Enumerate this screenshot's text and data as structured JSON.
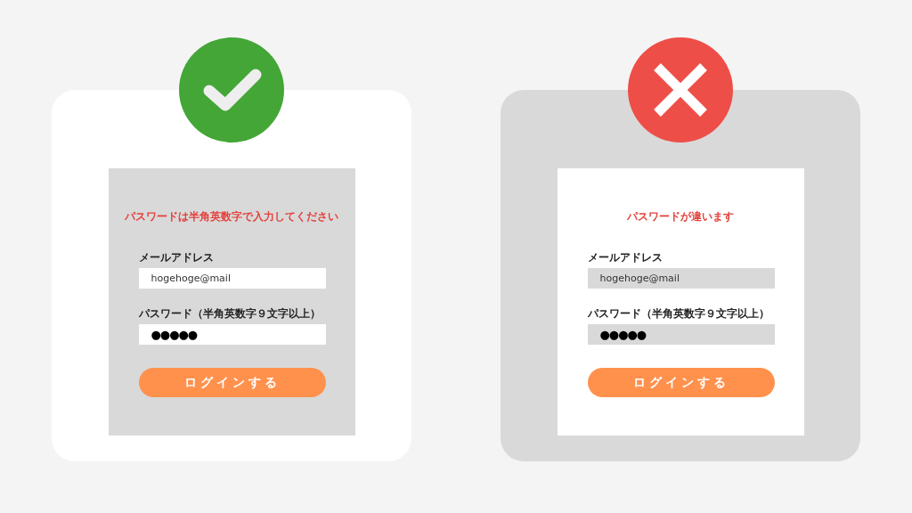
{
  "examples": [
    {
      "kind": "good",
      "error": "パスワードは半角英数字で入力してください",
      "email_label": "メールアドレス",
      "email_value": "hogehoge@mail",
      "password_label": "パスワード（半角英数字９文字以上）",
      "password_value": "●●●●●",
      "button": "ログインする"
    },
    {
      "kind": "bad",
      "error": "パスワードが違います",
      "email_label": "メールアドレス",
      "email_value": "hogehoge@mail",
      "password_label": "パスワード（半角英数字９文字以上）",
      "password_value": "●●●●●",
      "button": "ログインする"
    }
  ]
}
